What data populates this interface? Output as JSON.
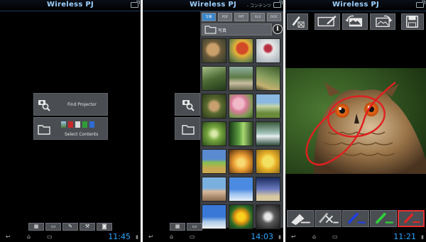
{
  "app_title": "Wireless PJ",
  "screen1": {
    "find_projector_label": "Find Projector",
    "select_contents_label": "Select Contents",
    "toolbar_icons": [
      "grid-icon",
      "folder-icon",
      "pencil-icon",
      "wrench-icon",
      "camera-icon"
    ],
    "clock": "11:45"
  },
  "screen2": {
    "header_label": "- コンテンツ",
    "tabs": [
      "写真",
      "PDF",
      "PPT",
      "XLS",
      "DOC"
    ],
    "folder_label": "写真",
    "clock": "14:03"
  },
  "screen3": {
    "clock": "11:21"
  },
  "colors": {
    "accent": "#2ea8ff",
    "title": "#9fd1ff",
    "pen_blue": "#1f3fe0",
    "pen_green": "#2fd13a",
    "pen_red": "#e02525"
  }
}
